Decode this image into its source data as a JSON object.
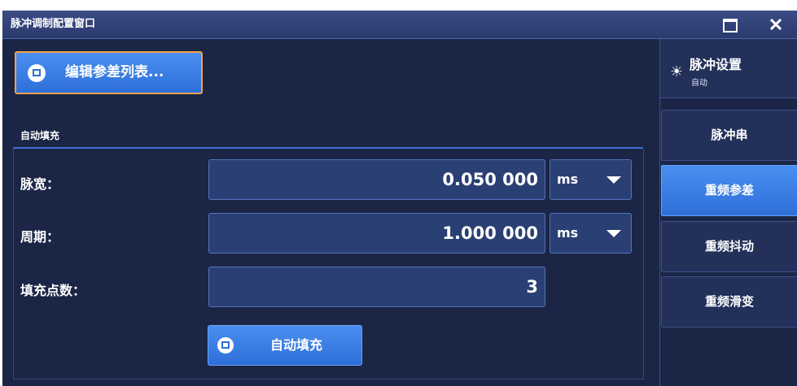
{
  "window": {
    "title": "脉冲调制配置窗口"
  },
  "toolbar": {
    "edit_list_label": "编辑参差列表..."
  },
  "form": {
    "section_label": "自动填充",
    "pulse_width": {
      "label": "脉宽：",
      "value": "0.050 000",
      "unit": "ms"
    },
    "period": {
      "label": "周期：",
      "value": "1.000 000",
      "unit": "ms"
    },
    "fill_points": {
      "label": "填充点数：",
      "value": "3"
    },
    "autofill_button_label": "自动填充"
  },
  "sidebar": {
    "header": {
      "title": "脉冲设置",
      "subtitle": "自动",
      "icon": "sun-icon"
    },
    "items": [
      {
        "label": "脉冲串",
        "active": false
      },
      {
        "label": "重频参差",
        "active": true
      },
      {
        "label": "重频抖动",
        "active": false
      },
      {
        "label": "重频滑变",
        "active": false
      }
    ]
  },
  "colors": {
    "background": "#1b2545",
    "accent_blue": "#3a7be6",
    "focus_orange": "#f2a24a",
    "field": "#2a3f73"
  }
}
